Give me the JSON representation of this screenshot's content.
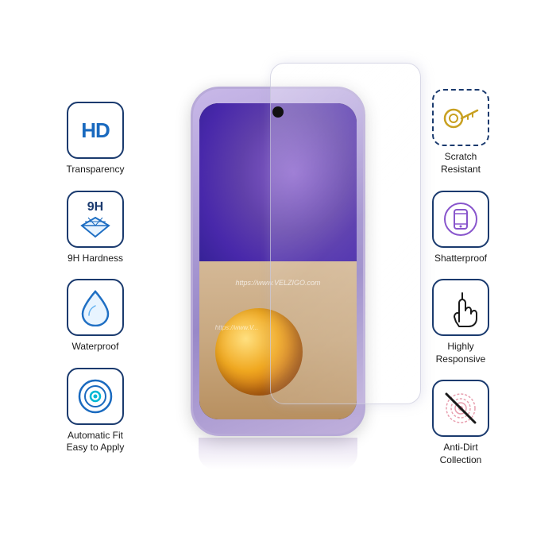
{
  "features": {
    "left": [
      {
        "id": "hd-transparency",
        "icon_type": "hd",
        "label": "Transparency"
      },
      {
        "id": "9h-hardness",
        "icon_type": "diamond",
        "label": "9H Hardness"
      },
      {
        "id": "waterproof",
        "icon_type": "water_drop",
        "label": "Waterproof"
      },
      {
        "id": "auto-fit",
        "icon_type": "circle_target",
        "label": "Automatic Fit\nEasy to Apply"
      }
    ],
    "right": [
      {
        "id": "scratch-resistant",
        "icon_type": "key",
        "label": "Scratch\nResistant"
      },
      {
        "id": "shatterproof",
        "icon_type": "phone_circle",
        "label": "Shatterproof"
      },
      {
        "id": "highly-responsive",
        "icon_type": "finger_touch",
        "label": "Highly\nResponsive"
      },
      {
        "id": "anti-dirt",
        "icon_type": "fingerprint_slash",
        "label": "Anti-Dirt\nCollection"
      }
    ]
  },
  "watermark": "https://www.VELZIGO.com",
  "watermark2": "https://www.V...",
  "brand": "VELZIGO"
}
